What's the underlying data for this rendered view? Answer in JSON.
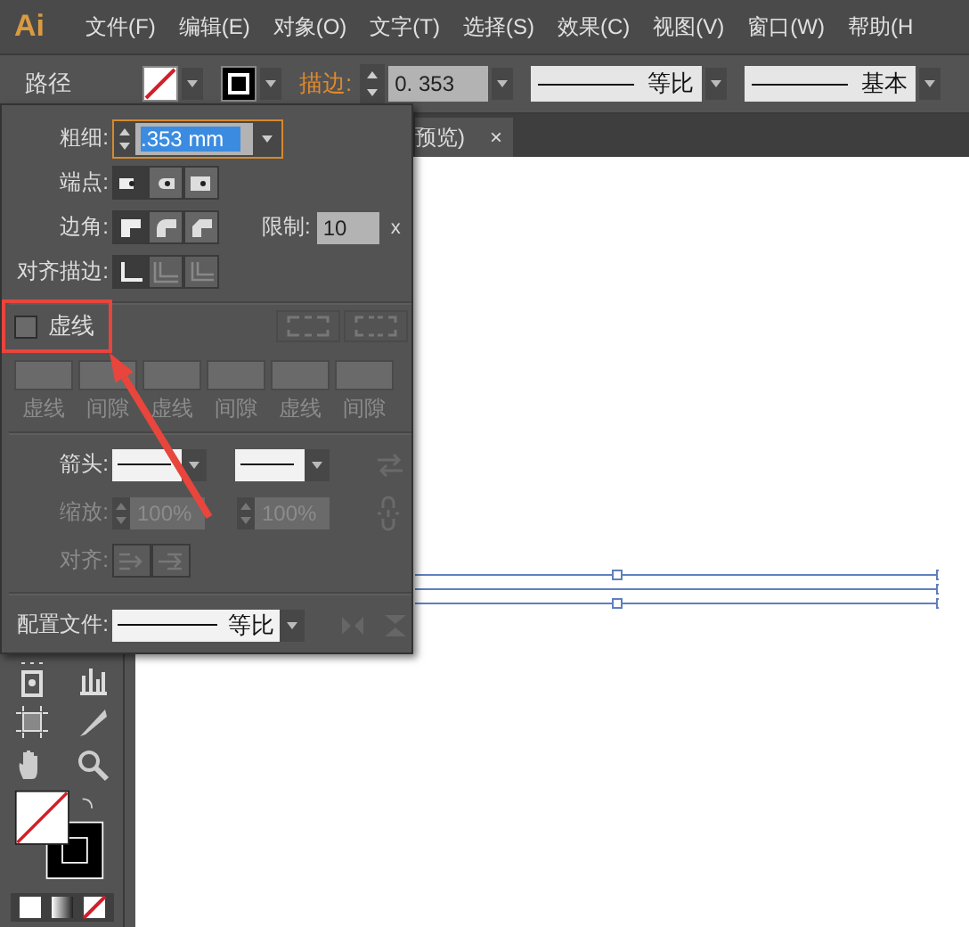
{
  "menu_bar": {
    "logo": "Ai",
    "items": [
      {
        "label": "文件(F)"
      },
      {
        "label": "编辑(E)"
      },
      {
        "label": "对象(O)"
      },
      {
        "label": "文字(T)"
      },
      {
        "label": "选择(S)"
      },
      {
        "label": "效果(C)"
      },
      {
        "label": "视图(V)"
      },
      {
        "label": "窗口(W)"
      },
      {
        "label": "帮助(H"
      }
    ]
  },
  "control_bar": {
    "object_label": "路径",
    "stroke_label": "描边:",
    "stroke_value": "0. 353",
    "brush": "等比",
    "style": "基本"
  },
  "document_tab": {
    "title": "预览)",
    "close": "×"
  },
  "stroke_panel": {
    "weight": {
      "label": "粗细:",
      "value": ".353 mm"
    },
    "caps": {
      "label": "端点:",
      "options": [
        {
          "kind": "butt",
          "selected": true
        },
        {
          "kind": "round",
          "selected": false
        },
        {
          "kind": "square",
          "selected": false
        }
      ]
    },
    "corners": {
      "label": "边角:",
      "options": [
        {
          "kind": "miter",
          "selected": true
        },
        {
          "kind": "round",
          "selected": false
        },
        {
          "kind": "bevel",
          "selected": false
        }
      ],
      "limit_label": "限制:",
      "limit_value": "10",
      "limit_unit": "x"
    },
    "align_stroke": {
      "label": "对齐描边:",
      "options": [
        {
          "kind": "center",
          "selected": true,
          "disabled": false
        },
        {
          "kind": "inside",
          "selected": false,
          "disabled": true
        },
        {
          "kind": "outside",
          "selected": false,
          "disabled": true
        }
      ]
    },
    "dashed": {
      "label": "虚线",
      "checked": false
    },
    "dash_fields": [
      {
        "label": "虚线"
      },
      {
        "label": "间隙"
      },
      {
        "label": "虚线"
      },
      {
        "label": "间隙"
      },
      {
        "label": "虚线"
      },
      {
        "label": "间隙"
      }
    ],
    "arrowheads": {
      "label": "箭头:"
    },
    "scale": {
      "label": "缩放:",
      "disabled": true,
      "values": [
        "100%",
        "100%"
      ]
    },
    "arrow_align": {
      "label": "对齐:",
      "disabled": true
    },
    "profile": {
      "label": "配置文件:",
      "value": "等比"
    }
  }
}
